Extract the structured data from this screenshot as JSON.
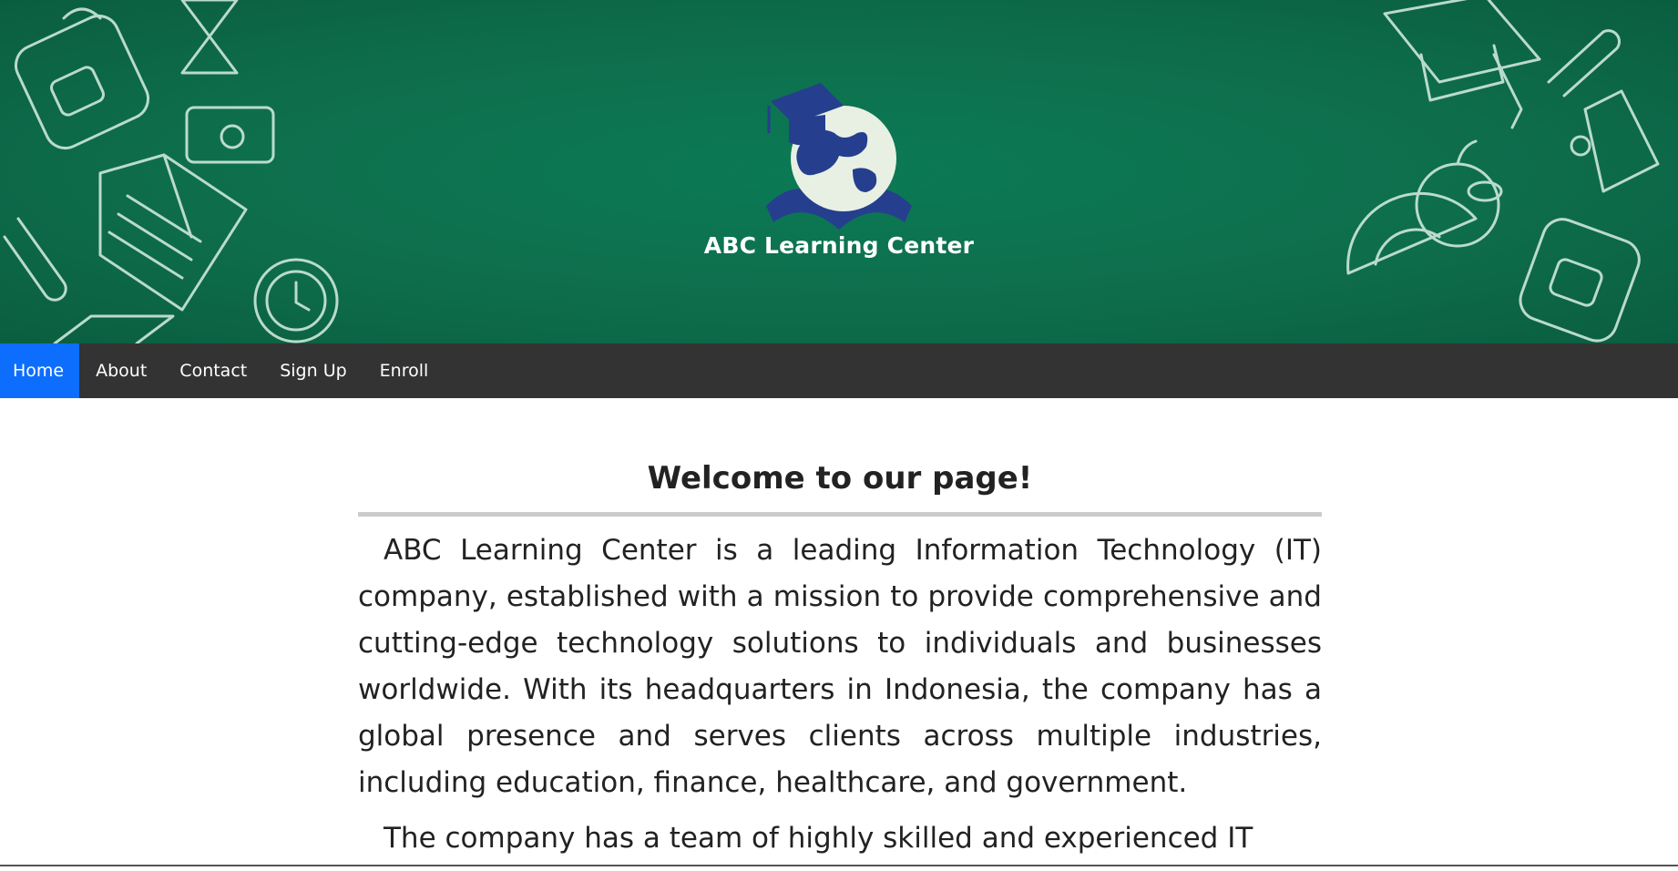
{
  "header": {
    "site_title": "ABC Learning Center",
    "logo_icon": "graduation-globe-book-icon",
    "background_color": "#0e6e4c",
    "doodle_color": "#d9efe4"
  },
  "navbar": {
    "background_color": "#333333",
    "active_color": "#0d6efd",
    "items": [
      {
        "label": "Home",
        "active": true
      },
      {
        "label": "About",
        "active": false
      },
      {
        "label": "Contact",
        "active": false
      },
      {
        "label": "Sign Up",
        "active": false
      },
      {
        "label": "Enroll",
        "active": false
      }
    ]
  },
  "main": {
    "title": "Welcome to our page!",
    "paragraphs": [
      "ABC Learning Center is a leading Information Technology (IT) company, established with a mission to provide comprehensive and cutting-edge technology solutions to individuals and businesses worldwide. With its headquarters in Indonesia, the company has a global presence and serves clients across multiple industries, including education, finance, healthcare, and government.",
      "The company has a team of highly skilled and experienced IT"
    ]
  }
}
